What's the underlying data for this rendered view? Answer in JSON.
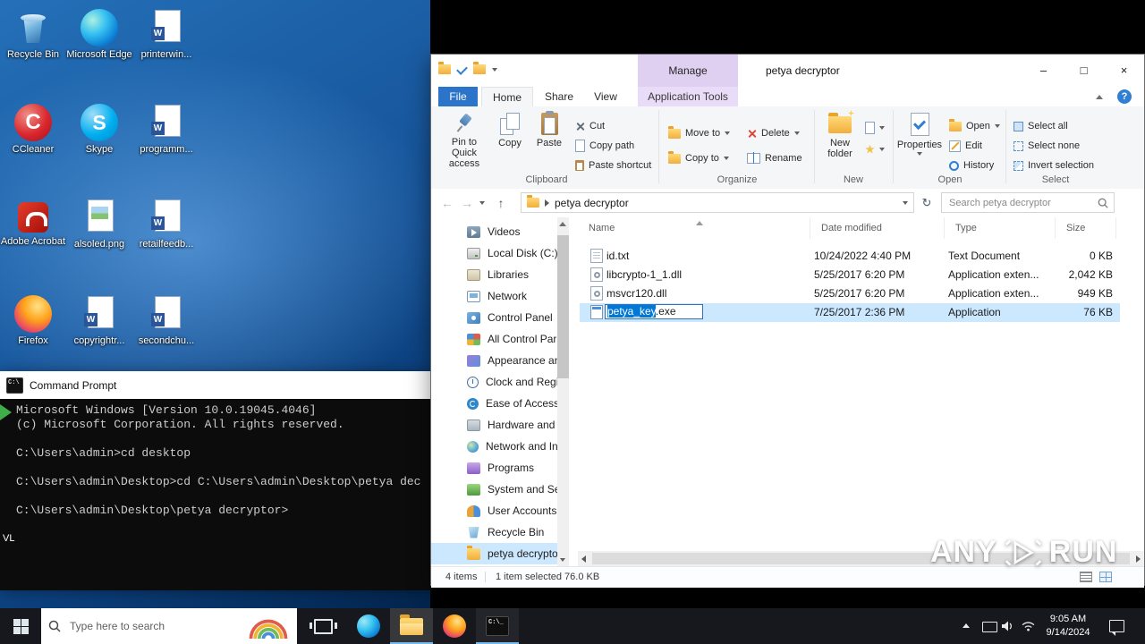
{
  "colors": {
    "accent": "#0078d7",
    "selection": "#cce8ff",
    "manage_purple": "#dfd0f2",
    "taskbar": "#16181d"
  },
  "desktop": {
    "icons": [
      {
        "label": "Recycle Bin",
        "icon": "recycle-bin"
      },
      {
        "label": "Microsoft Edge",
        "icon": "edge"
      },
      {
        "label": "printerwin...",
        "icon": "word-document"
      },
      {
        "label": "CCleaner",
        "icon": "ccleaner"
      },
      {
        "label": "Skype",
        "icon": "skype"
      },
      {
        "label": "programm...",
        "icon": "word-document"
      },
      {
        "label": "Adobe Acrobat",
        "icon": "acrobat"
      },
      {
        "label": "alsoled.png",
        "icon": "image-file"
      },
      {
        "label": "retailfeedb...",
        "icon": "word-document"
      },
      {
        "label": "Firefox",
        "icon": "firefox"
      },
      {
        "label": "copyrightr...",
        "icon": "word-document"
      },
      {
        "label": "secondchu...",
        "icon": "word-document"
      }
    ],
    "partial_label": "VL"
  },
  "cmd": {
    "title": "Command Prompt",
    "lines": [
      "Microsoft Windows [Version 10.0.19045.4046]",
      "(c) Microsoft Corporation. All rights reserved.",
      "",
      "C:\\Users\\admin>cd desktop",
      "",
      "C:\\Users\\admin\\Desktop>cd C:\\Users\\admin\\Desktop\\petya dec",
      "",
      "C:\\Users\\admin\\Desktop\\petya decryptor>"
    ]
  },
  "explorer": {
    "manage": "Manage",
    "title": "petya decryptor",
    "window_controls": {
      "minimize": "–",
      "maximize": "□",
      "close": "×"
    },
    "tabs": {
      "file": "File",
      "home": "Home",
      "share": "Share",
      "view": "View",
      "contextual": "Application Tools"
    },
    "help": "?",
    "ribbon": {
      "pin": "Pin to Quick access",
      "copy": "Copy",
      "paste": "Paste",
      "cut": "Cut",
      "copy_path": "Copy path",
      "paste_shortcut": "Paste shortcut",
      "clipboard_group": "Clipboard",
      "move_to": "Move to",
      "copy_to": "Copy to",
      "delete": "Delete",
      "rename": "Rename",
      "organize_group": "Organize",
      "new_folder": "New folder",
      "new_group": "New",
      "properties": "Properties",
      "open_item": "Open",
      "edit": "Edit",
      "history": "History",
      "open_group": "Open",
      "select_all": "Select all",
      "select_none": "Select none",
      "invert_selection": "Invert selection",
      "select_group": "Select"
    },
    "address": {
      "back": "←",
      "forward": "→",
      "up": "↑",
      "refresh": "↻",
      "path": "petya decryptor",
      "search_placeholder": "Search petya decryptor"
    },
    "nav": [
      {
        "label": "Videos",
        "icon": "videos"
      },
      {
        "label": "Local Disk (C:)",
        "icon": "local-disk"
      },
      {
        "label": "Libraries",
        "icon": "libraries"
      },
      {
        "label": "Network",
        "icon": "network"
      },
      {
        "label": "Control Panel",
        "icon": "control-panel"
      },
      {
        "label": "All Control Par",
        "icon": "control-panel-items"
      },
      {
        "label": "Appearance an",
        "icon": "appearance"
      },
      {
        "label": "Clock and Regi",
        "icon": "clock-region"
      },
      {
        "label": "Ease of Access",
        "icon": "ease-of-access"
      },
      {
        "label": "Hardware and",
        "icon": "hardware"
      },
      {
        "label": "Network and In",
        "icon": "network-internet"
      },
      {
        "label": "Programs",
        "icon": "programs"
      },
      {
        "label": "System and Se",
        "icon": "system-security"
      },
      {
        "label": "User Accounts",
        "icon": "user-accounts"
      },
      {
        "label": "Recycle Bin",
        "icon": "recycle-bin"
      },
      {
        "label": "petya decryptor",
        "icon": "folder"
      }
    ],
    "columns": [
      "Name",
      "Date modified",
      "Type",
      "Size"
    ],
    "files": [
      {
        "name": "id.txt",
        "date": "10/24/2022 4:40 PM",
        "type": "Text Document",
        "size": "0 KB",
        "icon": "text-file"
      },
      {
        "name": "libcrypto-1_1.dll",
        "date": "5/25/2017 6:20 PM",
        "type": "Application exten...",
        "size": "2,042 KB",
        "icon": "dll-file"
      },
      {
        "name": "msvcr120.dll",
        "date": "5/25/2017 6:20 PM",
        "type": "Application exten...",
        "size": "949 KB",
        "icon": "dll-file"
      },
      {
        "rename_base": "petya_key",
        "rename_ext": ".exe",
        "date": "7/25/2017 2:36 PM",
        "type": "Application",
        "size": "76 KB",
        "icon": "exe-file"
      }
    ],
    "status": {
      "items": "4 items",
      "selection": "1 item selected 76.0 KB"
    }
  },
  "watermark": {
    "left": "ANY",
    "right": "RUN"
  },
  "taskbar": {
    "search_placeholder": "Type here to search",
    "time": "9:05 AM",
    "date": "9/14/2024"
  }
}
